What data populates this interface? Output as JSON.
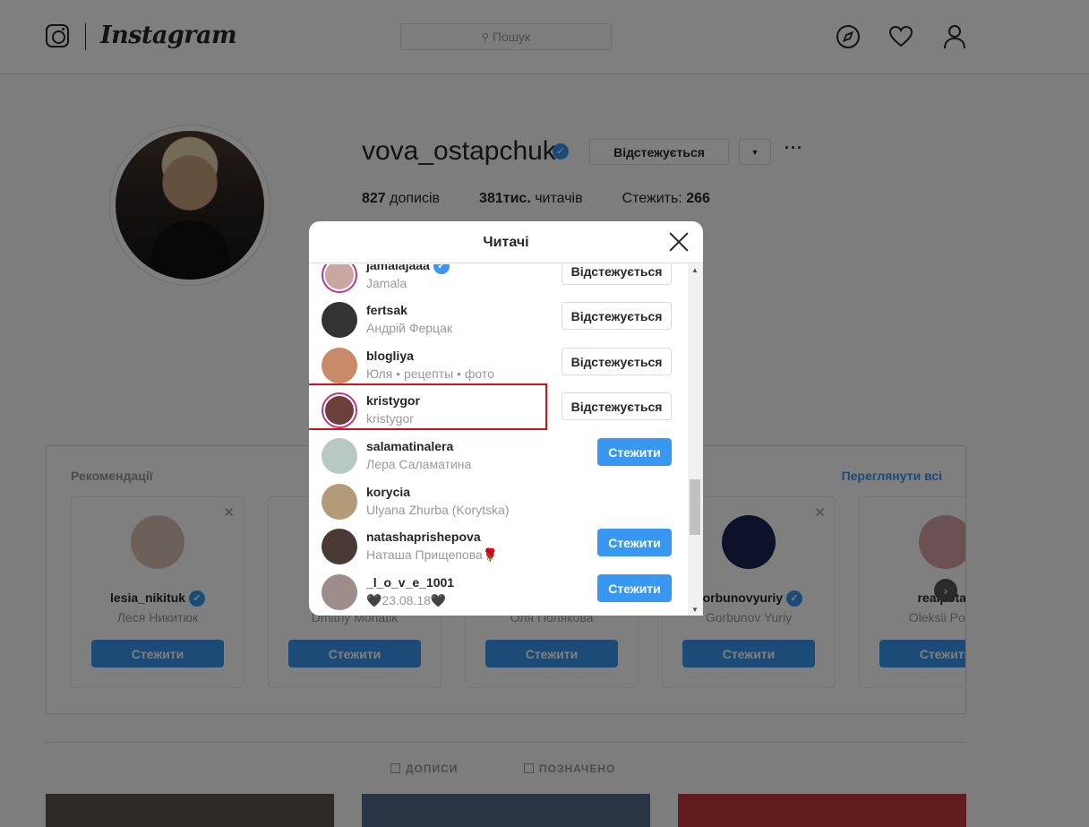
{
  "header": {
    "logo_text": "Instagram",
    "search_placeholder": "Пошук"
  },
  "profile": {
    "username": "vova_ostapchuk",
    "follow_button": "Відстежується",
    "posts_count": "827",
    "posts_label": "дописів",
    "followers_count": "381тис.",
    "followers_label": "читачів",
    "following_label": "Стежить:",
    "following_count": "266"
  },
  "recommendations": {
    "title": "Рекомендації",
    "see_all": "Переглянути всі",
    "follow_label": "Стежити",
    "cards": [
      {
        "username": "lesia_nikituk",
        "name": "Леся Никитюк",
        "verified": true,
        "avatar_color": "#d9c3b5"
      },
      {
        "username": "mo",
        "name": "Dmitriy Monatik",
        "verified": false,
        "avatar_color": "#a79a8c"
      },
      {
        "username": "",
        "name": "Оля Полякова",
        "verified": false,
        "avatar_color": "#c9b7a6"
      },
      {
        "username": "gorbunovyuriy",
        "name": "Gorbunov Yuriy",
        "verified": true,
        "avatar_color": "#1a2452"
      },
      {
        "username": "realpotap",
        "name": "Oleksii Potap",
        "verified": false,
        "avatar_color": "#d7a3a6"
      }
    ]
  },
  "tabs": {
    "posts": "ДОПИСИ",
    "saved": "ПОЗНАЧЕНО"
  },
  "modal": {
    "title": "Читачі",
    "rows": [
      {
        "username": "jamalajaaa",
        "name": "Jamala",
        "button": "Відстежується",
        "button_type": "following",
        "story": true,
        "avatar_color": "#c9a6a0"
      },
      {
        "username": "fertsak",
        "name": "Андрій Ферцак",
        "button": "Відстежується",
        "button_type": "following",
        "story": false,
        "avatar_color": "#333333"
      },
      {
        "username": "blogliya",
        "name": "Юля • рецепты • фото",
        "button": "Відстежується",
        "button_type": "following",
        "story": false,
        "avatar_color": "#c78b6a"
      },
      {
        "username": "kristygor",
        "name": "kristygor",
        "button": "Відстежується",
        "button_type": "following",
        "story": true,
        "avatar_color": "#6b3f3a"
      },
      {
        "username": "salamatinalera",
        "name": "Лера Саламатина",
        "button": "Стежити",
        "button_type": "follow",
        "story": false,
        "avatar_color": "#b8c9c4"
      },
      {
        "username": "korycia",
        "name": "Ulyana Zhurba (Korytska)",
        "button": "",
        "button_type": "none",
        "story": false,
        "avatar_color": "#b39a79"
      },
      {
        "username": "natashaprishepova",
        "name": "Наташа Прищепова🌹",
        "button": "Стежити",
        "button_type": "follow",
        "story": false,
        "avatar_color": "#4a3a36"
      },
      {
        "username": "_l_o_v_e_1001",
        "name": "🖤23.08.18🖤",
        "button": "Стежити",
        "button_type": "follow",
        "story": false,
        "avatar_color": "#9e8d8a"
      }
    ]
  }
}
